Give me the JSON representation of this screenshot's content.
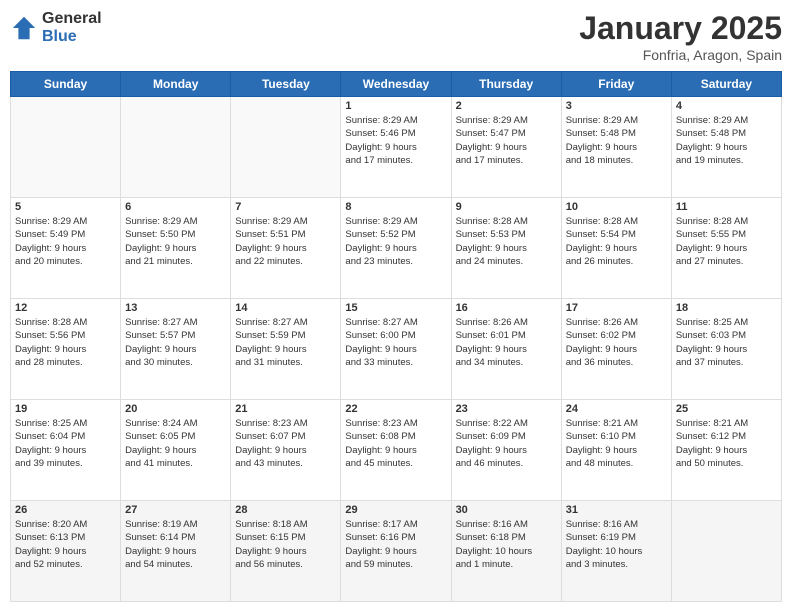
{
  "logo": {
    "general": "General",
    "blue": "Blue"
  },
  "header": {
    "month": "January 2025",
    "location": "Fonfria, Aragon, Spain"
  },
  "weekdays": [
    "Sunday",
    "Monday",
    "Tuesday",
    "Wednesday",
    "Thursday",
    "Friday",
    "Saturday"
  ],
  "weeks": [
    [
      {
        "day": "",
        "info": ""
      },
      {
        "day": "",
        "info": ""
      },
      {
        "day": "",
        "info": ""
      },
      {
        "day": "1",
        "info": "Sunrise: 8:29 AM\nSunset: 5:46 PM\nDaylight: 9 hours\nand 17 minutes."
      },
      {
        "day": "2",
        "info": "Sunrise: 8:29 AM\nSunset: 5:47 PM\nDaylight: 9 hours\nand 17 minutes."
      },
      {
        "day": "3",
        "info": "Sunrise: 8:29 AM\nSunset: 5:48 PM\nDaylight: 9 hours\nand 18 minutes."
      },
      {
        "day": "4",
        "info": "Sunrise: 8:29 AM\nSunset: 5:48 PM\nDaylight: 9 hours\nand 19 minutes."
      }
    ],
    [
      {
        "day": "5",
        "info": "Sunrise: 8:29 AM\nSunset: 5:49 PM\nDaylight: 9 hours\nand 20 minutes."
      },
      {
        "day": "6",
        "info": "Sunrise: 8:29 AM\nSunset: 5:50 PM\nDaylight: 9 hours\nand 21 minutes."
      },
      {
        "day": "7",
        "info": "Sunrise: 8:29 AM\nSunset: 5:51 PM\nDaylight: 9 hours\nand 22 minutes."
      },
      {
        "day": "8",
        "info": "Sunrise: 8:29 AM\nSunset: 5:52 PM\nDaylight: 9 hours\nand 23 minutes."
      },
      {
        "day": "9",
        "info": "Sunrise: 8:28 AM\nSunset: 5:53 PM\nDaylight: 9 hours\nand 24 minutes."
      },
      {
        "day": "10",
        "info": "Sunrise: 8:28 AM\nSunset: 5:54 PM\nDaylight: 9 hours\nand 26 minutes."
      },
      {
        "day": "11",
        "info": "Sunrise: 8:28 AM\nSunset: 5:55 PM\nDaylight: 9 hours\nand 27 minutes."
      }
    ],
    [
      {
        "day": "12",
        "info": "Sunrise: 8:28 AM\nSunset: 5:56 PM\nDaylight: 9 hours\nand 28 minutes."
      },
      {
        "day": "13",
        "info": "Sunrise: 8:27 AM\nSunset: 5:57 PM\nDaylight: 9 hours\nand 30 minutes."
      },
      {
        "day": "14",
        "info": "Sunrise: 8:27 AM\nSunset: 5:59 PM\nDaylight: 9 hours\nand 31 minutes."
      },
      {
        "day": "15",
        "info": "Sunrise: 8:27 AM\nSunset: 6:00 PM\nDaylight: 9 hours\nand 33 minutes."
      },
      {
        "day": "16",
        "info": "Sunrise: 8:26 AM\nSunset: 6:01 PM\nDaylight: 9 hours\nand 34 minutes."
      },
      {
        "day": "17",
        "info": "Sunrise: 8:26 AM\nSunset: 6:02 PM\nDaylight: 9 hours\nand 36 minutes."
      },
      {
        "day": "18",
        "info": "Sunrise: 8:25 AM\nSunset: 6:03 PM\nDaylight: 9 hours\nand 37 minutes."
      }
    ],
    [
      {
        "day": "19",
        "info": "Sunrise: 8:25 AM\nSunset: 6:04 PM\nDaylight: 9 hours\nand 39 minutes."
      },
      {
        "day": "20",
        "info": "Sunrise: 8:24 AM\nSunset: 6:05 PM\nDaylight: 9 hours\nand 41 minutes."
      },
      {
        "day": "21",
        "info": "Sunrise: 8:23 AM\nSunset: 6:07 PM\nDaylight: 9 hours\nand 43 minutes."
      },
      {
        "day": "22",
        "info": "Sunrise: 8:23 AM\nSunset: 6:08 PM\nDaylight: 9 hours\nand 45 minutes."
      },
      {
        "day": "23",
        "info": "Sunrise: 8:22 AM\nSunset: 6:09 PM\nDaylight: 9 hours\nand 46 minutes."
      },
      {
        "day": "24",
        "info": "Sunrise: 8:21 AM\nSunset: 6:10 PM\nDaylight: 9 hours\nand 48 minutes."
      },
      {
        "day": "25",
        "info": "Sunrise: 8:21 AM\nSunset: 6:12 PM\nDaylight: 9 hours\nand 50 minutes."
      }
    ],
    [
      {
        "day": "26",
        "info": "Sunrise: 8:20 AM\nSunset: 6:13 PM\nDaylight: 9 hours\nand 52 minutes."
      },
      {
        "day": "27",
        "info": "Sunrise: 8:19 AM\nSunset: 6:14 PM\nDaylight: 9 hours\nand 54 minutes."
      },
      {
        "day": "28",
        "info": "Sunrise: 8:18 AM\nSunset: 6:15 PM\nDaylight: 9 hours\nand 56 minutes."
      },
      {
        "day": "29",
        "info": "Sunrise: 8:17 AM\nSunset: 6:16 PM\nDaylight: 9 hours\nand 59 minutes."
      },
      {
        "day": "30",
        "info": "Sunrise: 8:16 AM\nSunset: 6:18 PM\nDaylight: 10 hours\nand 1 minute."
      },
      {
        "day": "31",
        "info": "Sunrise: 8:16 AM\nSunset: 6:19 PM\nDaylight: 10 hours\nand 3 minutes."
      },
      {
        "day": "",
        "info": ""
      }
    ]
  ]
}
